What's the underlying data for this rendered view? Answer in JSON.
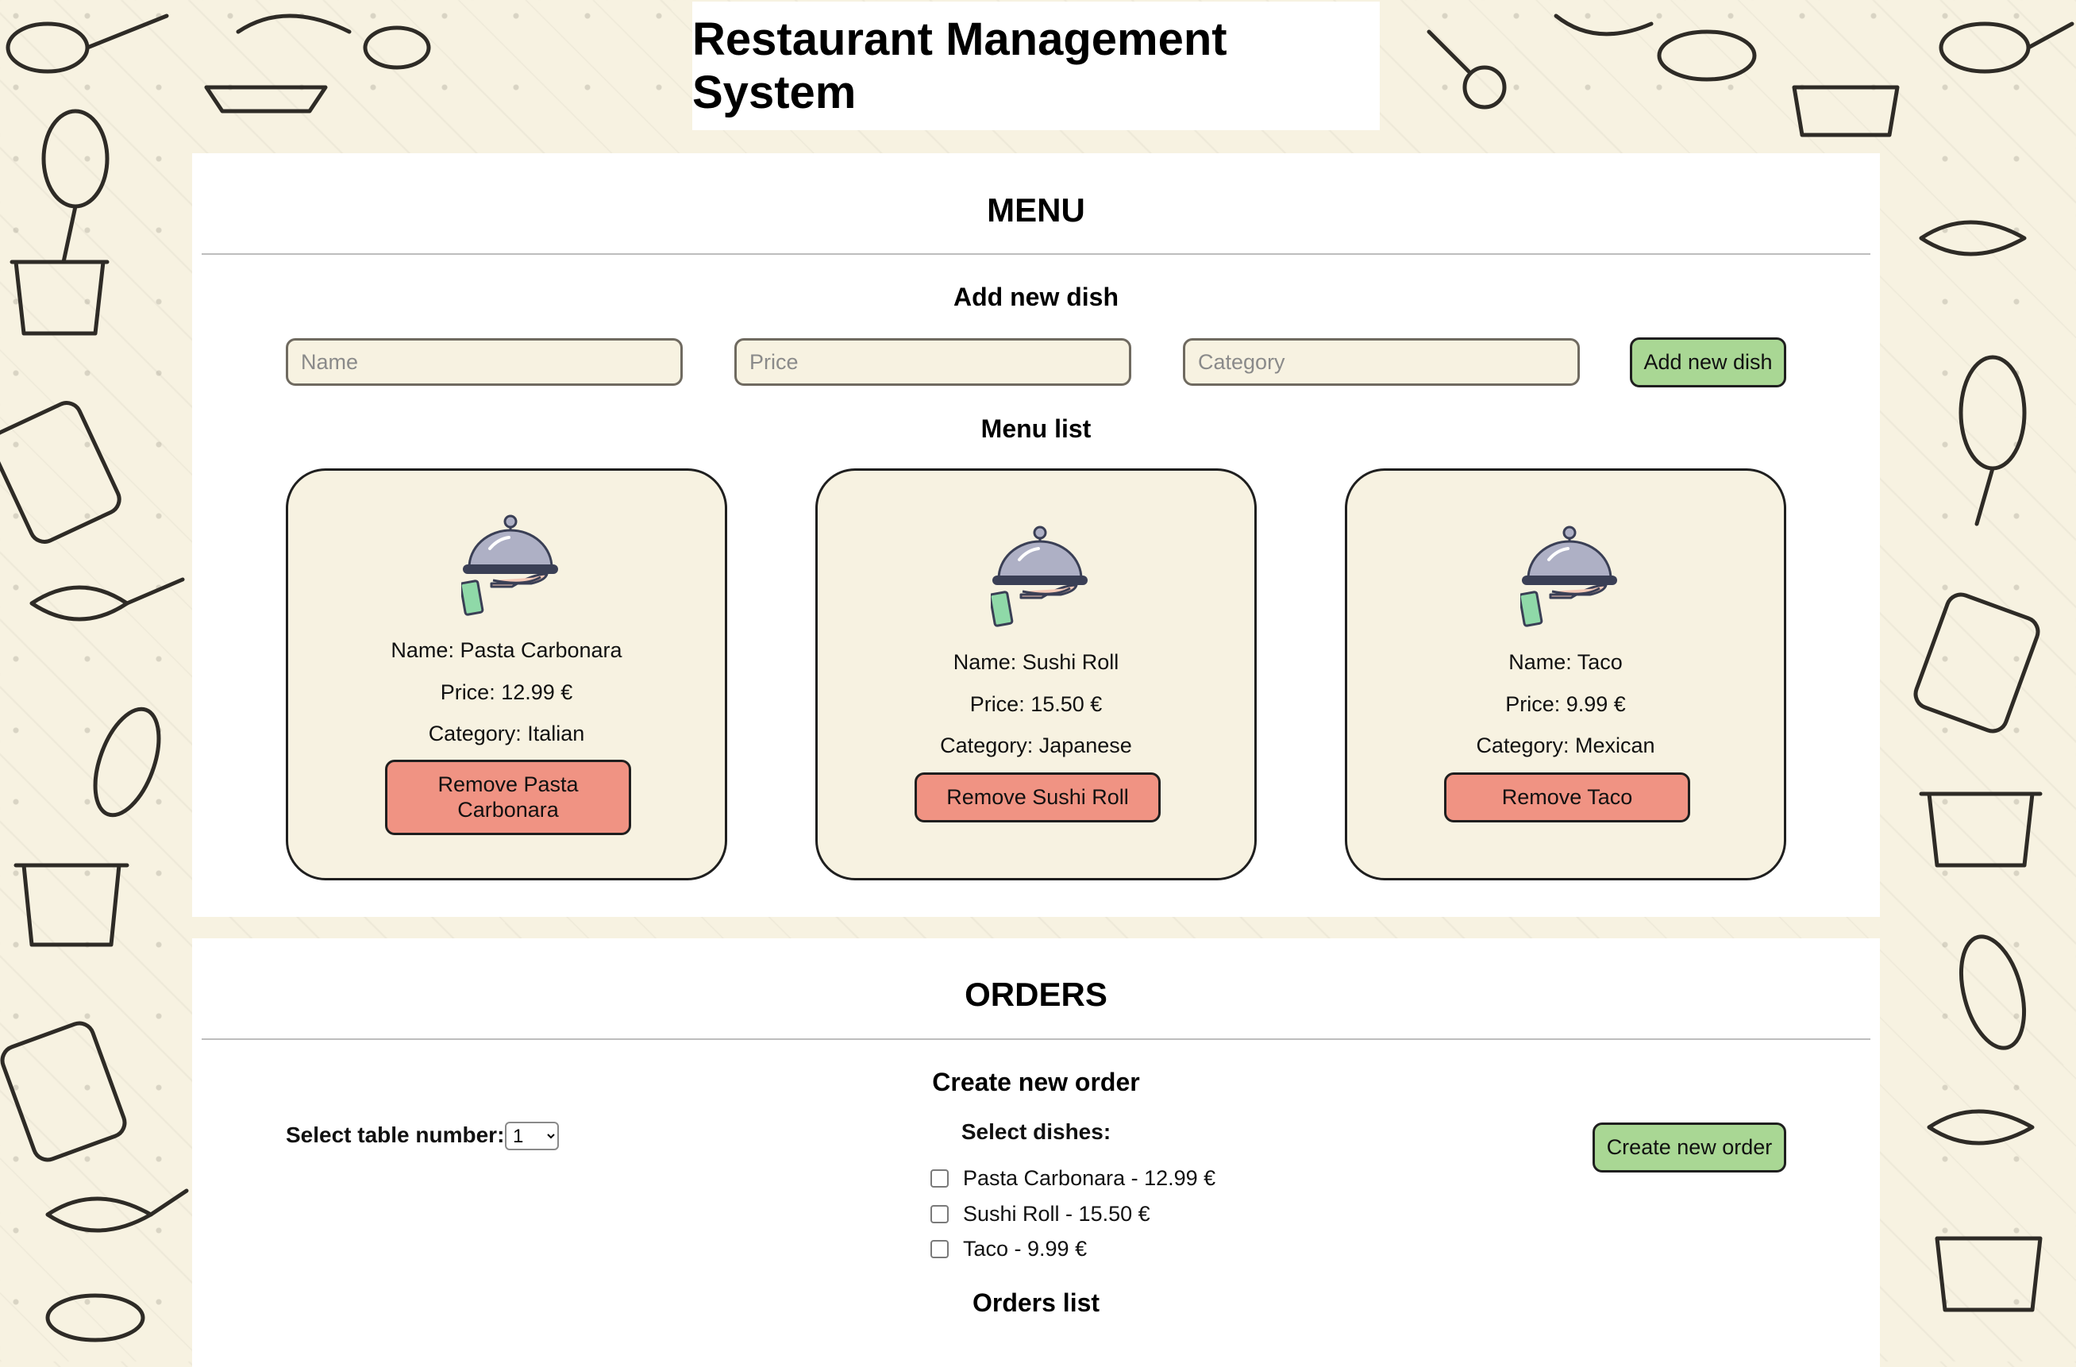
{
  "app": {
    "title": "Restaurant Management System"
  },
  "menu": {
    "heading": "MENU",
    "add_dish": {
      "title": "Add new dish",
      "name_placeholder": "Name",
      "price_placeholder": "Price",
      "category_placeholder": "Category",
      "button_label": "Add new dish"
    },
    "list_title": "Menu list",
    "dishes": [
      {
        "name": "Name: Pasta Carbonara",
        "price": "Price: 12.99 €",
        "category": "Category: Italian",
        "remove_label": "Remove Pasta Carbonara"
      },
      {
        "name": "Name: Sushi Roll",
        "price": "Price: 15.50 €",
        "category": "Category: Japanese",
        "remove_label": "Remove Sushi Roll"
      },
      {
        "name": "Name: Taco",
        "price": "Price: 9.99 €",
        "category": "Category: Mexican",
        "remove_label": "Remove Taco"
      }
    ]
  },
  "orders": {
    "heading": "ORDERS",
    "create_title": "Create new order",
    "table_label": "Select table number:",
    "table_value": "1",
    "dishes_label": "Select dishes:",
    "dish_options": [
      {
        "label": "Pasta Carbonara - 12.99 €",
        "checked": false
      },
      {
        "label": "Sushi Roll - 15.50 €",
        "checked": false
      },
      {
        "label": "Taco - 9.99 €",
        "checked": false
      }
    ],
    "create_button_label": "Create new order",
    "list_title": "Orders list"
  },
  "colors": {
    "background": "#f7f2e1",
    "add_button": "#a9d794",
    "remove_button": "#f09383",
    "card_background": "#f7f2e1"
  },
  "icons": {
    "dish_icon": "serving-cloche-icon"
  }
}
